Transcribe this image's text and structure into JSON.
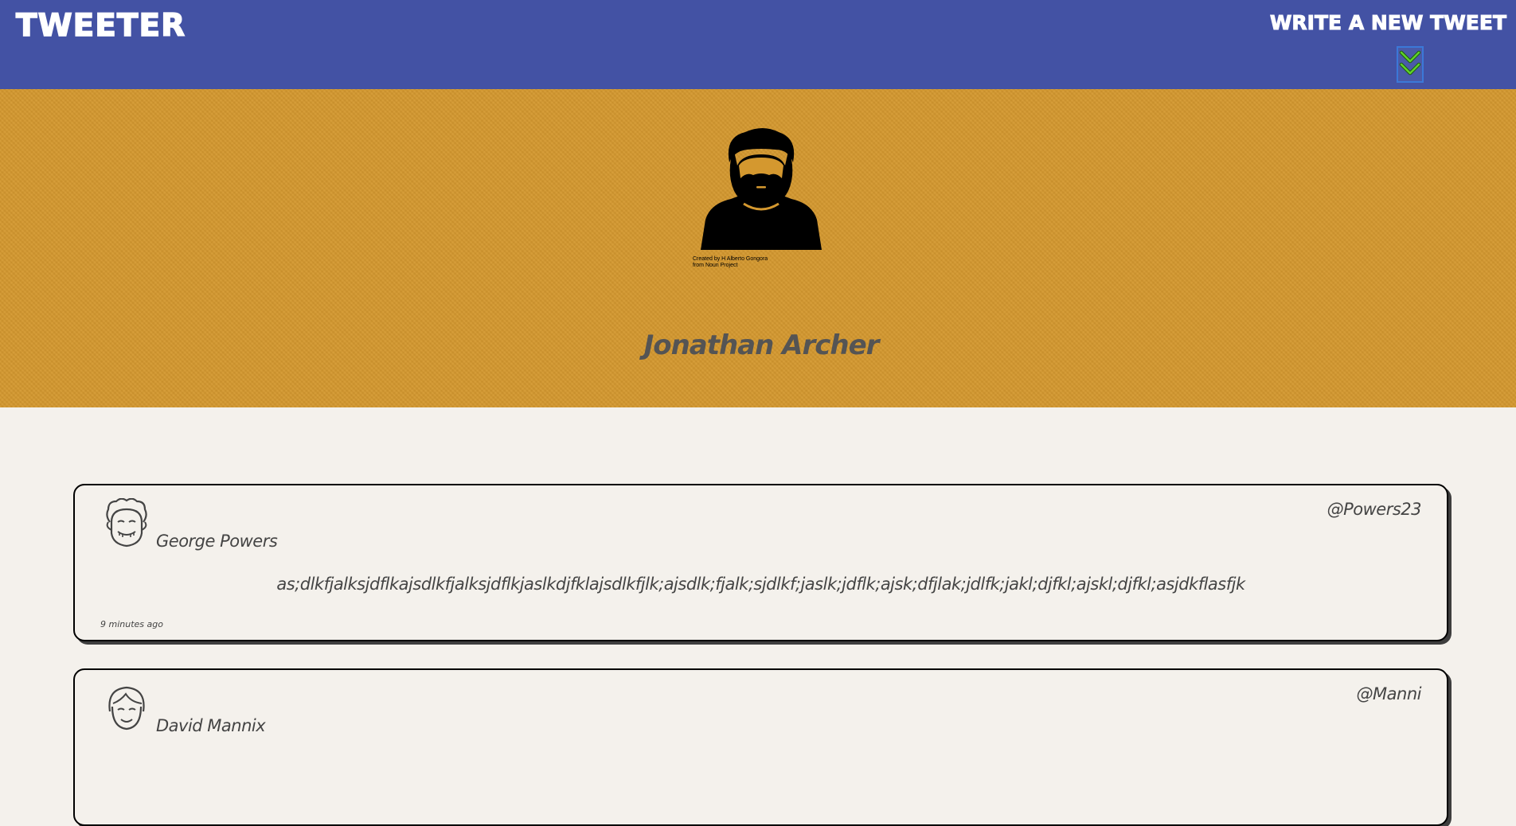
{
  "nav": {
    "brand": "TWEETER",
    "compose_label": "WRITE A NEW TWEET",
    "compose_icon": "double-chevron-down-icon"
  },
  "profile": {
    "avatar_icon": "bearded-man-icon",
    "credit_line1": "Created by H Alberto Gongora",
    "credit_line2": "from Noun Project",
    "name": "Jonathan Archer"
  },
  "tweets": [
    {
      "avatar_icon": "curly-hair-face-icon",
      "name": "George Powers",
      "handle": "@Powers23",
      "content": "as;dlkfjalksjdflkajsdlkfjalksjdflkjaslkdjfklajsdlkfjlk;ajsdlk;fjalk;sjdlkf;jaslk;jdflk;ajsk;dfjlak;jdlfk;jakl;djfkl;ajskl;djfkl;asjdkflasfjk",
      "time": "9 minutes ago"
    },
    {
      "avatar_icon": "smiling-face-icon",
      "name": "David Mannix",
      "handle": "@Manni",
      "content": "",
      "time": ""
    }
  ],
  "colors": {
    "nav_bg": "#4352a4",
    "header_bg": "#d4982f",
    "page_bg": "#f4f1ec",
    "text": "#444444",
    "toggle_accent": "#3b78d8",
    "chevron": "#55cc22"
  }
}
